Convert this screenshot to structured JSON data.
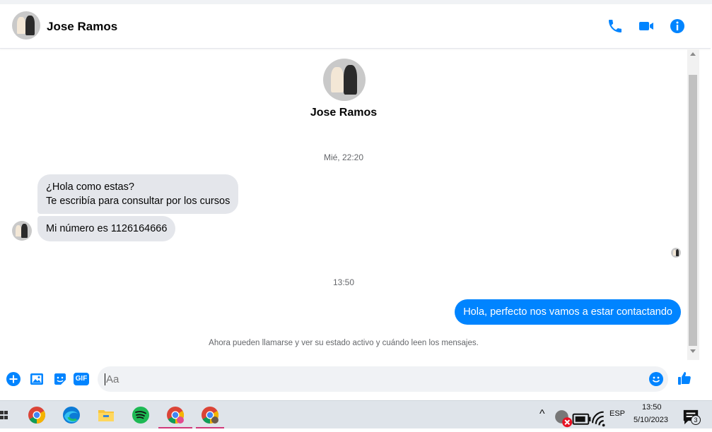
{
  "colors": {
    "accent": "#0084ff",
    "incoming_bubble": "#e4e6eb"
  },
  "header": {
    "contact_name": "Jose Ramos",
    "icons": [
      "phone-icon",
      "video-camera-icon",
      "info-icon"
    ]
  },
  "conversation": {
    "profile_name": "Jose Ramos",
    "day_stamp": "Mié, 22:20",
    "incoming": [
      {
        "line1": "¿Hola como estas?",
        "line2": "Te escribía para consultar por los cursos"
      },
      {
        "line1": "Mi número es 1126164666"
      }
    ],
    "time_stamp": "13:50",
    "outgoing": [
      {
        "text": "Hola, perfecto nos vamos a estar contactando"
      }
    ],
    "notice": "Ahora pueden llamarse y ver su estado activo y cuándo leen los mensajes."
  },
  "composer": {
    "placeholder": "Aa",
    "icons": [
      "plus-icon",
      "photo-icon",
      "sticker-icon",
      "gif-icon",
      "emoji-icon",
      "like-icon"
    ],
    "gif_label": "GIF"
  },
  "taskbar": {
    "apps": [
      "task-view-icon",
      "chrome-icon",
      "edge-icon",
      "file-explorer-icon",
      "spotify-icon",
      "chrome-profile-icon",
      "chrome-profile-icon-2"
    ],
    "tray": {
      "language": "ESP",
      "time": "13:50",
      "date": "5/10/2023",
      "notification_count": "3"
    }
  }
}
